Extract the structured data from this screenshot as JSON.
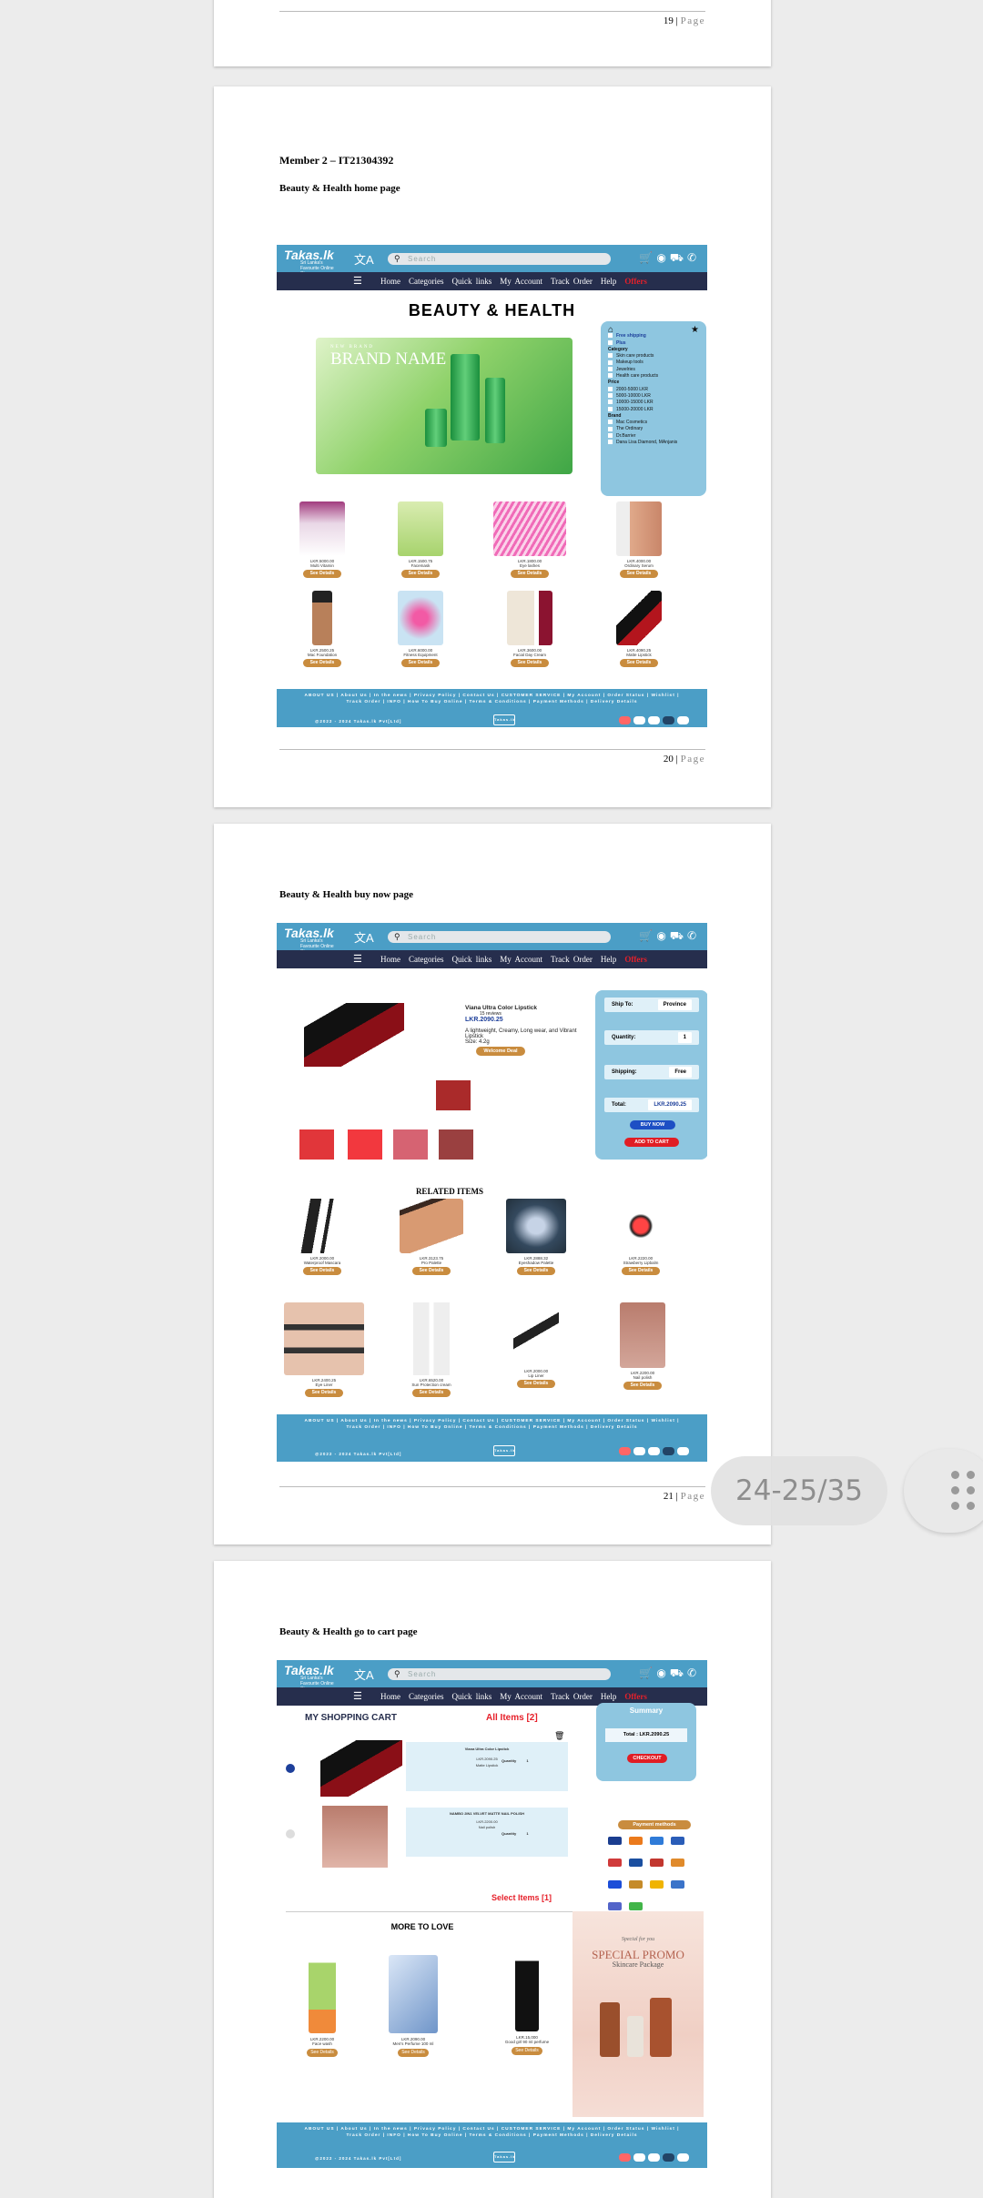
{
  "viewer": {
    "page_indicator": "24-25/35"
  },
  "pages": {
    "p19": {
      "num": "19",
      "sep": " | ",
      "label": "Page"
    },
    "p20": {
      "num": "20",
      "sep": " | ",
      "label": "Page",
      "member_line": "Member 2 – IT21304392",
      "section_title": "Beauty & Health home page"
    },
    "p21": {
      "num": "21",
      "sep": " | ",
      "label": "Page",
      "section_title": "Beauty & Health buy now page"
    },
    "p22": {
      "section_title": "Beauty & Health go to cart page"
    }
  },
  "site": {
    "logo": "Takas.lk",
    "logo_sub": "Sri Lanka's Favourite Online Store",
    "search_placeholder": "Search",
    "nav": [
      "Home",
      "Categories",
      "Quick links",
      "My Account",
      "Track Order",
      "Help"
    ],
    "offers": "Offers",
    "footer_links": "ABOUT US | About Us | In the news | Privacy Policy | Contact Us | CUSTOMER SERVICE | My Account | Order Status | Wishlist | Track Order | INFO | How To Buy Online | Terms & Conditions | Payment Methods | Delivery Details",
    "footer_copy": "@2022 - 2024 Takas.lk Pvt[Ltd]"
  },
  "home": {
    "title": "BEAUTY & HEALTH",
    "banner_brand": "BRAND NAME",
    "banner_tag": "NEW BRAND",
    "filter": {
      "free_shipping": "Free shipping",
      "plus": "Plus",
      "category_label": "Category",
      "categories": [
        "Skin care products",
        "Makeup tools",
        "Jewelries",
        "Health care products"
      ],
      "price_label": "Price",
      "prices": [
        "2000-5000 LKR",
        "5000-10000 LKR",
        "10000-15000 LKR",
        "15000-20000 LKR"
      ],
      "brand_label": "Brand",
      "brands": [
        "Mac Cosmetics",
        "The Ordinary",
        "Dr.Barrier",
        "Dana Lisa Diamond, MAnjanis"
      ]
    },
    "products": [
      {
        "price": "LKR.5000.00",
        "name": "Multi Vitamin"
      },
      {
        "price": "LKR.1500.75",
        "name": "Facemask"
      },
      {
        "price": "LKR.1800.00",
        "name": "Eye lashes"
      },
      {
        "price": "LKR.4000.00",
        "name": "Ordinary Serum"
      },
      {
        "price": "LKR.2500.25",
        "name": "Mac Foundation"
      },
      {
        "price": "LKR.6000.00",
        "name": "Fitness Equipment"
      },
      {
        "price": "LKR.3600.00",
        "name": "Facial Day Cream"
      },
      {
        "price": "LKR.4090.25",
        "name": "Matte Lipstick"
      }
    ],
    "see_details": "See Details"
  },
  "buy": {
    "product_name": "Viana Ultra Color Lipstick",
    "reviews": "15 reviews",
    "price": "LKR.2090.25",
    "desc": "A lightweight, Creamy, Long wear, and Vibrant Lipstick",
    "size": "Size: 4.2g",
    "welcome": "Welcome Deal",
    "ship_to": "Ship To:",
    "ship_val": "Province",
    "quantity": "Quantity:",
    "qty_val": "1",
    "shipping": "Shipping:",
    "shipping_val": "Free",
    "total": "Total:",
    "total_val": "LKR.2090.25",
    "buy_now": "BUY NOW",
    "add_to_cart": "ADD TO CART",
    "related_title": "RELATED ITEMS",
    "related": [
      {
        "price": "LKR.2000.00",
        "name": "Waterproof Mascara"
      },
      {
        "price": "LKR.3123.75",
        "name": "Pro Palette"
      },
      {
        "price": "LKR.2888.32",
        "name": "Eyeshadow Palette"
      },
      {
        "price": "LKR.2220.00",
        "name": "Strawberry Lipbalm"
      },
      {
        "price": "LKR.2400.25",
        "name": "Eye Liner"
      },
      {
        "price": "LKR.6520.00",
        "name": "Sun Protection cream"
      },
      {
        "price": "LKR.2000.00",
        "name": "Lip Liner"
      },
      {
        "price": "LKR.2200.00",
        "name": "Nail polish"
      }
    ],
    "swatch_colors": [
      "#e1363a",
      "#f2383e",
      "#d66372",
      "#9a4040",
      "#aa2a2a"
    ]
  },
  "cart": {
    "title": "MY SHOPPING CART",
    "all_items": "All Items [2]",
    "summary": "Summary",
    "total": "Total : LKR.2090.25",
    "checkout": "CHECKOUT",
    "payment_methods": "Payment methods",
    "items": [
      {
        "name": "Viana Ultra Color Lipstick",
        "price": "LKR.2090.25",
        "sub": "Matte Lipstick",
        "qty_label": "Quantity",
        "qty": "1"
      },
      {
        "name": "NAMBO 2IN1 VELVET MATTE NAIL POLISH",
        "price": "LKR.2200.00",
        "sub": "Nail polish",
        "qty_label": "Quantity",
        "qty": "1"
      }
    ],
    "select_items": "Select Items [1]",
    "more_to_love": "MORE TO LOVE",
    "love": [
      {
        "price": "LKR.2200.00",
        "name": "Face wash"
      },
      {
        "price": "LKR.2090.00",
        "name": "Men's Perfume 100 ml"
      },
      {
        "price": "LKR.15,000",
        "name": "Good girl 90 ml perfume"
      }
    ],
    "promo_small": "Special for you",
    "promo_title": "SPECIAL PROMO",
    "promo_sub": "Skincare Package",
    "see_details": "See Details"
  },
  "colors": {
    "brand_blue": "#4b9ec6",
    "nav_dark": "#262e4d",
    "accent_orange": "#c98c3e",
    "red": "#e6202a"
  }
}
